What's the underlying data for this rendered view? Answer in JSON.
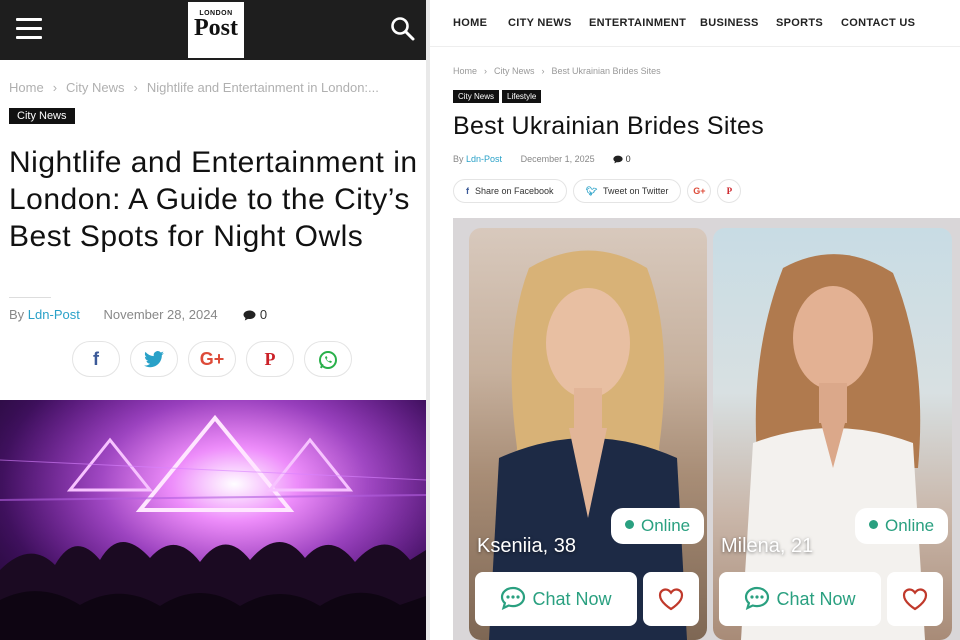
{
  "left": {
    "logo": {
      "top_text": "LONDON",
      "main_text": "Post"
    },
    "breadcrumb": [
      "Home",
      "City News",
      "Nightlife and Entertainment in London:..."
    ],
    "category": "City News",
    "title": "Nightlife and Entertainment in London: A Guide to the City’s Best Spots for Night Owls",
    "meta": {
      "by": "By",
      "author": "Ldn-Post",
      "date": "November 28, 2024",
      "comments": "0"
    },
    "social_icons": [
      "facebook-icon",
      "twitter-icon",
      "google-plus-icon",
      "pinterest-icon",
      "whatsapp-icon"
    ]
  },
  "right": {
    "nav": [
      "HOME",
      "CITY NEWS",
      "ENTERTAINMENT",
      "BUSINESS",
      "SPORTS",
      "CONTACT US"
    ],
    "breadcrumb": [
      "Home",
      "City News",
      "Best Ukrainian Brides Sites"
    ],
    "categories": [
      "City News",
      "Lifestyle"
    ],
    "title": "Best Ukrainian Brides Sites",
    "meta": {
      "by": "By",
      "author": "Ldn-Post",
      "date": "December 1, 2025",
      "comments": "0"
    },
    "share": {
      "facebook": "Share on Facebook",
      "twitter": "Tweet on Twitter",
      "gplus": "G+",
      "pinterest": "P"
    },
    "profiles": [
      {
        "name": "Kseniia, 38",
        "status": "Online",
        "chat": "Chat Now"
      },
      {
        "name": "Milena, 21",
        "status": "Online",
        "chat": "Chat Now"
      }
    ]
  },
  "colors": {
    "accent_link": "#29a1c8",
    "online_green": "#2aa080",
    "heart_red": "#c0392b",
    "topbar": "#1e1e1e"
  }
}
